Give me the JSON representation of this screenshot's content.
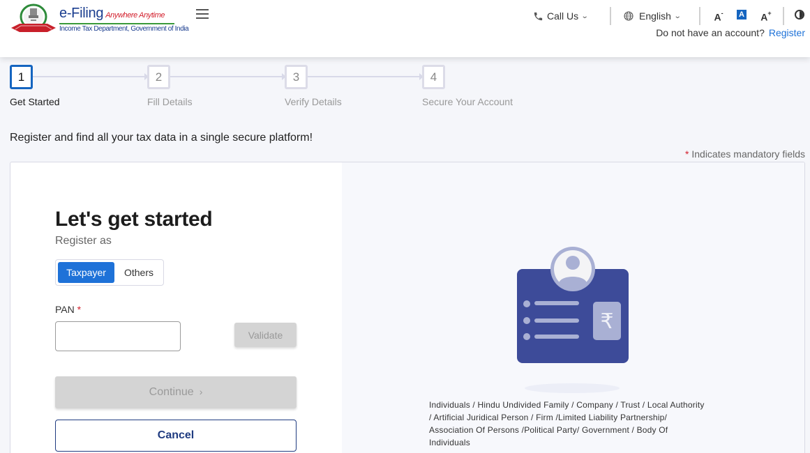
{
  "header": {
    "logo": {
      "title": "e-Filing",
      "tagline": "Anywhere Anytime",
      "subtitle": "Income Tax Department, Government of India",
      "emblem_icon": "income-tax-department-emblem"
    },
    "menu_icon": "hamburger-icon",
    "call_us": {
      "label": "Call Us",
      "icon": "phone-icon"
    },
    "language": {
      "label": "English",
      "icon": "globe-icon"
    },
    "font_controls": {
      "decrease": "A",
      "default": "A",
      "increase": "A",
      "decrease_mark": "-",
      "increase_mark": "+"
    },
    "contrast_icon": "contrast-icon",
    "account_prompt": "Do not have an account?",
    "register_link": "Register"
  },
  "stepper": {
    "steps": [
      {
        "number": "1",
        "label": "Get Started",
        "active": true
      },
      {
        "number": "2",
        "label": "Fill Details",
        "active": false
      },
      {
        "number": "3",
        "label": "Verify Details",
        "active": false
      },
      {
        "number": "4",
        "label": "Secure Your Account",
        "active": false
      }
    ]
  },
  "intro_text": "Register and find all your tax data in a single secure platform!",
  "mandatory_note": {
    "star": "*",
    "text": "Indicates mandatory fields"
  },
  "form": {
    "title": "Let's get started",
    "register_as_label": "Register as",
    "register_as_options": [
      {
        "label": "Taxpayer",
        "selected": true
      },
      {
        "label": "Others",
        "selected": false
      }
    ],
    "pan": {
      "label": "PAN",
      "required_mark": "*",
      "value": "",
      "placeholder": ""
    },
    "validate_label": "Validate",
    "continue_label": "Continue",
    "continue_arrow": "›",
    "cancel_label": "Cancel"
  },
  "side_panel": {
    "illustration": "taxpayer-id-card-illustration",
    "currency_symbol": "₹",
    "entity_types": "Individuals / Hindu Undivided Family / Company / Trust / Local Authority / Artificial Juridical Person / Firm /Limited Liability Partnership/ Association Of Persons /Political Party/ Government / Body Of Individuals"
  },
  "colors": {
    "primary": "#1e72d8",
    "navy": "#1f3b80",
    "illustration_blue": "#3d4b99",
    "illustration_light": "#a9b0d4",
    "required": "#d3202d",
    "disabled": "#d4d4d4"
  }
}
